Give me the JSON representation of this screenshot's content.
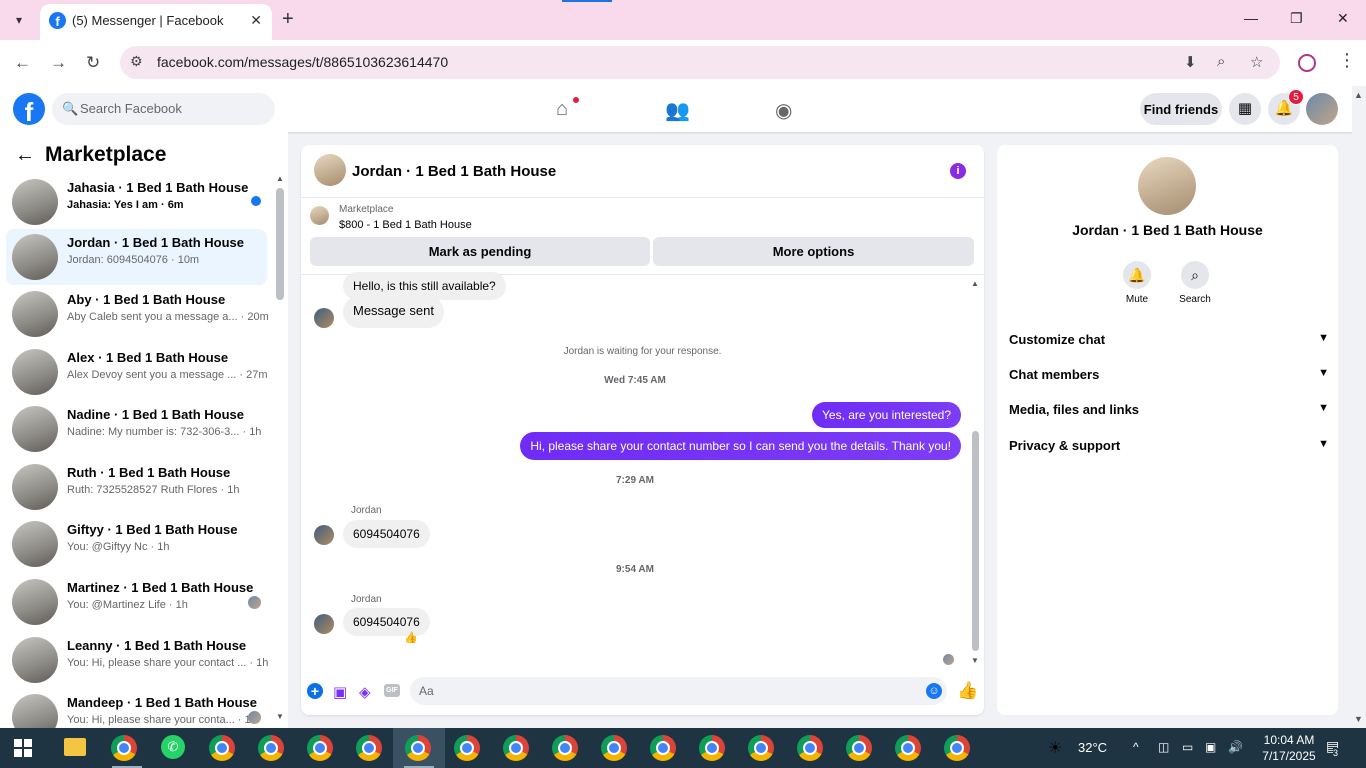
{
  "browser": {
    "tab_title": "(5) Messenger | Facebook",
    "url": "facebook.com/messages/t/8865103623614470"
  },
  "fb_header": {
    "search_placeholder": "Search Facebook",
    "find_friends_label": "Find friends",
    "notification_count": "5"
  },
  "left_panel": {
    "title": "Marketplace",
    "conversations": [
      {
        "name": "Jahasia · 1 Bed 1 Bath House",
        "preview": "Jahasia: Yes I am · 6m",
        "unread": true
      },
      {
        "name": "Jordan · 1 Bed 1 Bath House",
        "preview": "Jordan: 6094504076 · 10m",
        "active": true
      },
      {
        "name": "Aby · 1 Bed 1 Bath House",
        "preview": "Aby Caleb sent you a message a... · 20m"
      },
      {
        "name": "Alex · 1 Bed 1 Bath House",
        "preview": "Alex Devoy sent you a message ... · 27m"
      },
      {
        "name": "Nadine · 1 Bed 1 Bath House",
        "preview": "Nadine: My number is: 732-306-3... · 1h"
      },
      {
        "name": "Ruth · 1 Bed 1 Bath House",
        "preview": "Ruth: 7325528527 Ruth Flores · 1h"
      },
      {
        "name": "Giftyy · 1 Bed 1 Bath House",
        "preview": "You: @Giftyy Nc · 1h"
      },
      {
        "name": "Martinez · 1 Bed 1 Bath House",
        "preview": "You: @Martinez Life · 1h",
        "seen": true
      },
      {
        "name": "Leanny · 1 Bed 1 Bath House",
        "preview": "You: Hi, please share your contact ... · 1h"
      },
      {
        "name": "Mandeep · 1 Bed 1 Bath House",
        "preview": "You: Hi, please share your conta... · 1h",
        "seen": true
      }
    ]
  },
  "chat": {
    "title": "Jordan · 1 Bed 1 Bath House",
    "listing_source": "Marketplace",
    "listing_price": "$800 - 1 Bed 1 Bath House",
    "mark_pending_label": "Mark as pending",
    "more_options_label": "More options",
    "messages": {
      "in1": "Hello, is this still available?",
      "in2": "Message sent",
      "waiting": "Jordan is waiting for your response.",
      "time1": "Wed 7:45 AM",
      "out1": "Yes, are you interested?",
      "out2": "Hi, please share your contact number so I can send you the details. Thank you!",
      "time2": "7:29 AM",
      "sender1": "Jordan",
      "in3": "6094504076",
      "time3": "9:54 AM",
      "sender2": "Jordan",
      "in4": "6094504076",
      "reaction": "👍"
    },
    "composer_placeholder": "Aa",
    "gif_label": "GIF"
  },
  "right_panel": {
    "name": "Jordan · 1 Bed 1 Bath House",
    "mute_label": "Mute",
    "search_label": "Search",
    "sections": [
      "Customize chat",
      "Chat members",
      "Media, files and links",
      "Privacy & support"
    ]
  },
  "taskbar": {
    "temperature": "32°C",
    "time": "10:04 AM",
    "date": "7/17/2025",
    "notification_count": "3"
  },
  "colors": {
    "fb_blue": "#1877f2",
    "messenger_purple": "#7b2ff7",
    "tabbar_pink": "#f9d9ec",
    "taskbar": "#1f3443"
  }
}
